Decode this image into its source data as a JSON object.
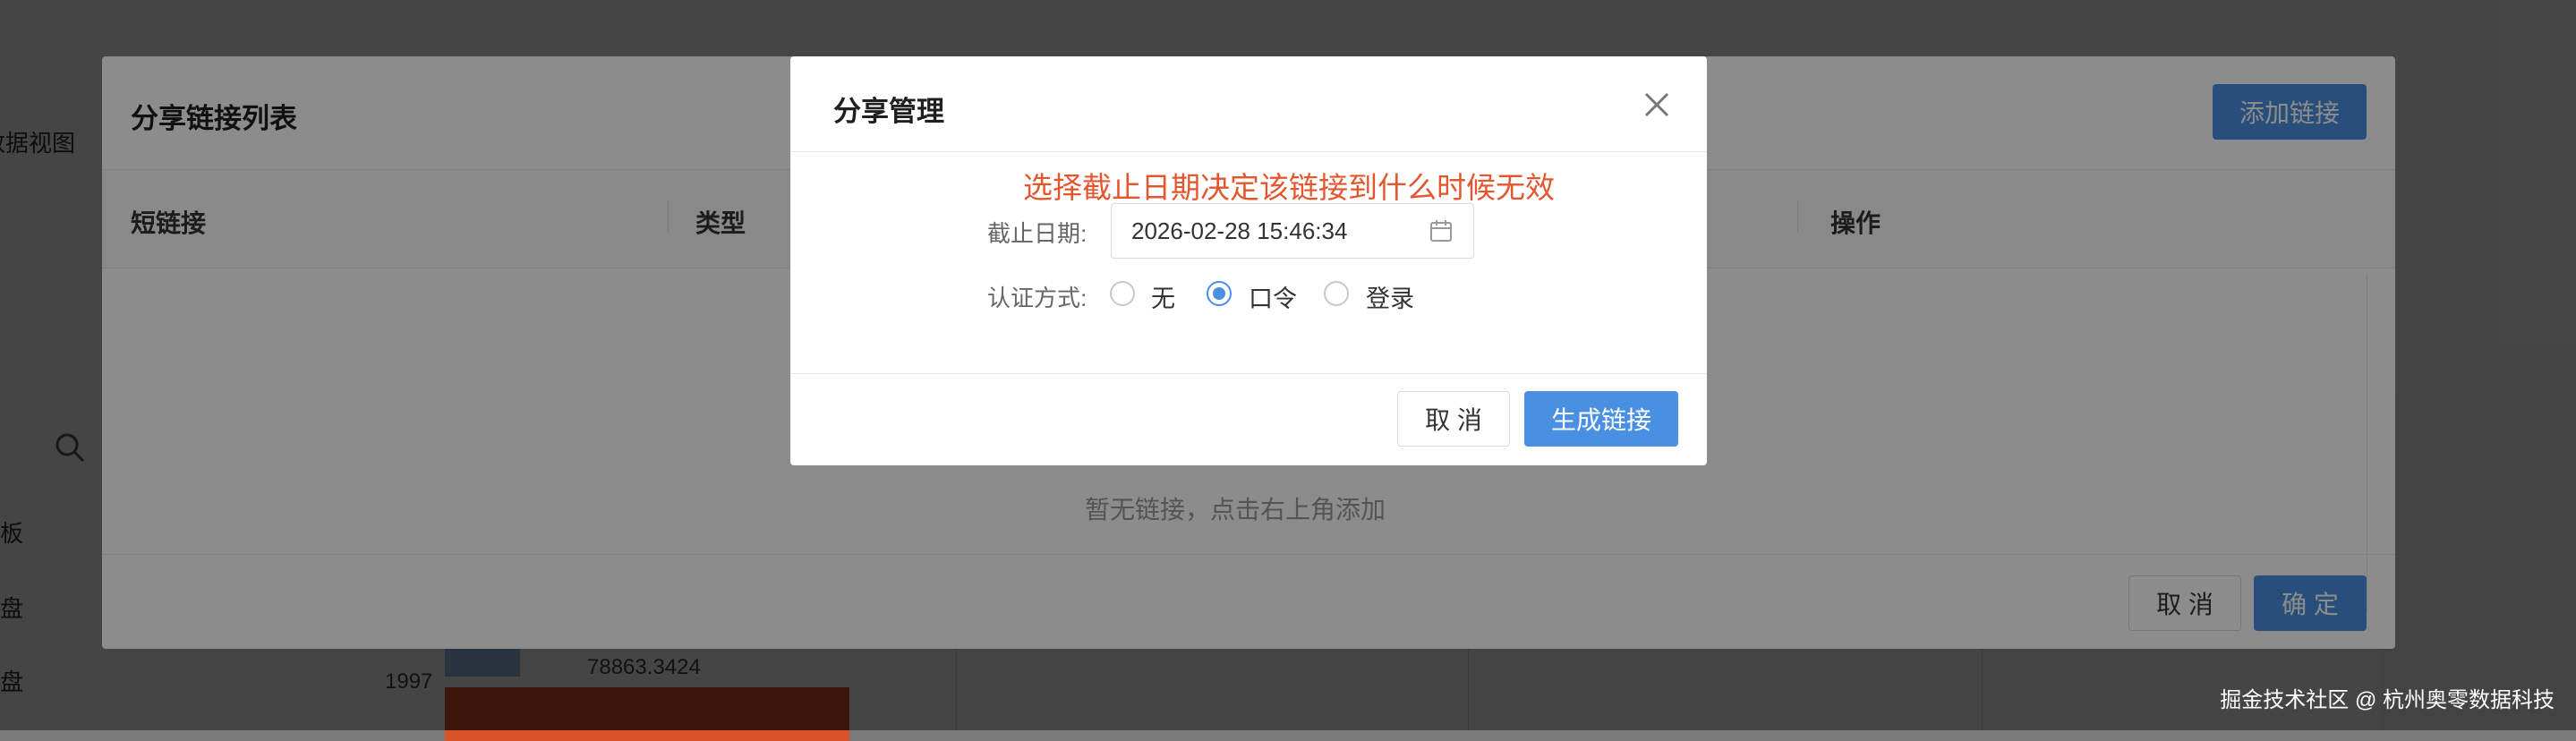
{
  "background": {
    "left_items": [
      "数据视图",
      "看板",
      "仪表盘",
      "仪表盘"
    ],
    "chart_year": "1997",
    "chart_value": "78863.3424"
  },
  "share_list_dialog": {
    "title": "分享链接列表",
    "add_button": "添加链接",
    "columns": [
      "短链接",
      "类型",
      "操作"
    ],
    "empty_text": "暂无链接，点击右上角添加",
    "cancel_button": "取 消",
    "ok_button": "确 定"
  },
  "share_manage_dialog": {
    "title": "分享管理",
    "hint": "选择截止日期决定该链接到什么时候无效",
    "deadline_label": "截止日期:",
    "deadline_value": "2026-02-28 15:46:34",
    "auth_label": "认证方式:",
    "auth_options": [
      "无",
      "口令",
      "登录"
    ],
    "auth_selected": "口令",
    "cancel_button": "取 消",
    "generate_button": "生成链接"
  },
  "colors": {
    "accent": "#4a90e2",
    "hint": "#e4572e"
  },
  "icons": [
    "close-icon",
    "calendar-icon",
    "search-icon"
  ],
  "watermark": "掘金技术社区 @ 杭州奥零数据科技"
}
